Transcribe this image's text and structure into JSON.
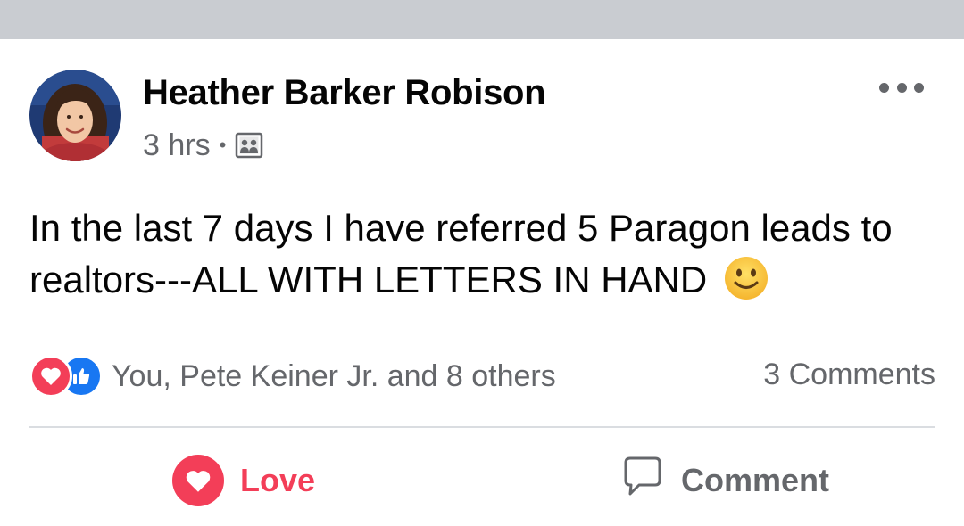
{
  "post": {
    "author": "Heather Barker Robison",
    "time": "3 hrs",
    "separator": "•",
    "audience_icon": "group-audience-icon",
    "text": "In the last 7 days I have referred 5 Paragon leads to realtors---ALL WITH LETTERS IN HAND",
    "emoji": "slightly-smiling-face"
  },
  "reactions": {
    "types": [
      "love",
      "like"
    ],
    "summary": "You, Pete Keiner Jr. and 8 others"
  },
  "comments": {
    "count_label": "3 Comments"
  },
  "actions": {
    "love_label": "Love",
    "comment_label": "Comment"
  },
  "colors": {
    "top_bar": "#c9ccd1",
    "love": "#f33e58",
    "like": "#1877f2",
    "secondary_text": "#65676b",
    "primary_text": "#050505"
  }
}
